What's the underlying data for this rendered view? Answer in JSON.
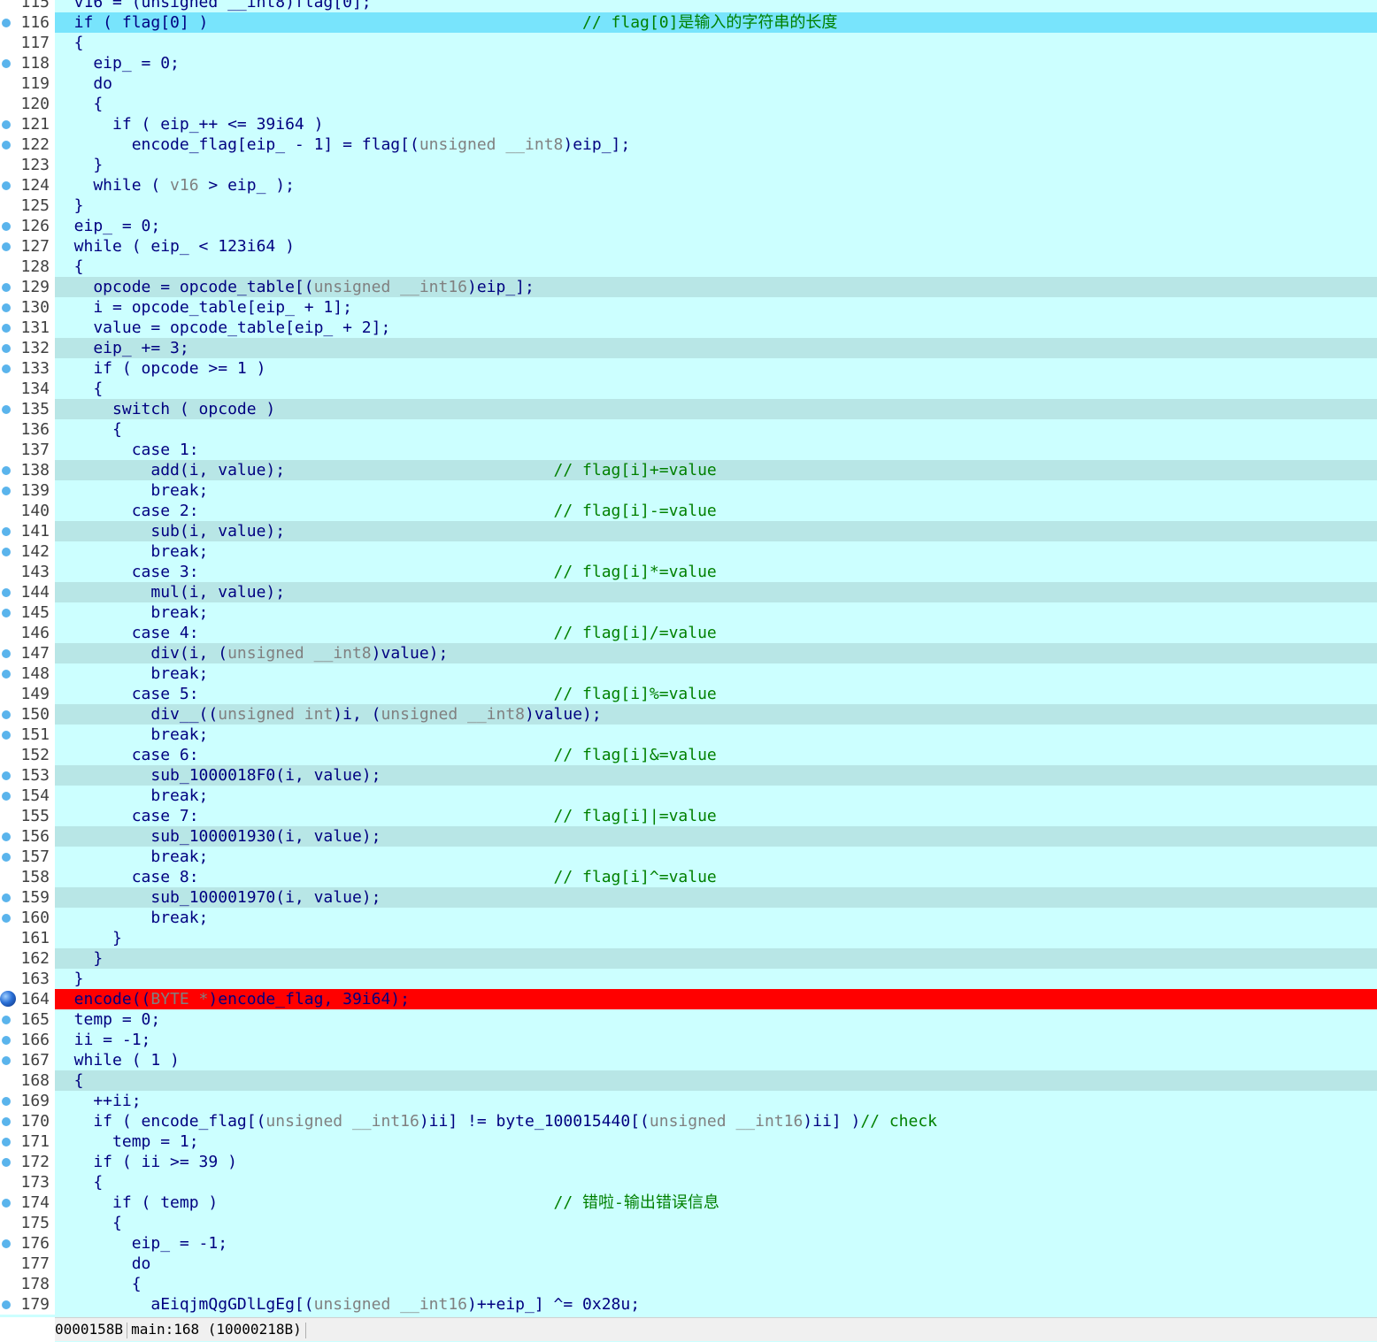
{
  "editor": {
    "lines": [
      {
        "n": "115",
        "seg": [
          [
            "  v16 = (unsigned __int8)flag[0];",
            "nm"
          ]
        ],
        "bp": false,
        "hl": ""
      },
      {
        "n": "116",
        "seg": [
          [
            "  if ( flag[0] )                                       ",
            "nm"
          ],
          [
            "// flag[0]是输入的字符串的长度",
            "cm"
          ]
        ],
        "bp": true,
        "hl": "cur"
      },
      {
        "n": "117",
        "seg": [
          [
            "  {",
            "nm"
          ]
        ],
        "bp": false,
        "hl": ""
      },
      {
        "n": "118",
        "seg": [
          [
            "    eip_ = 0;",
            "nm"
          ]
        ],
        "bp": true,
        "hl": ""
      },
      {
        "n": "119",
        "seg": [
          [
            "    do",
            "nm"
          ]
        ],
        "bp": false,
        "hl": ""
      },
      {
        "n": "120",
        "seg": [
          [
            "    {",
            "nm"
          ]
        ],
        "bp": false,
        "hl": ""
      },
      {
        "n": "121",
        "seg": [
          [
            "      if ( eip_++ <= 39i64 )",
            "nm"
          ]
        ],
        "bp": true,
        "hl": ""
      },
      {
        "n": "122",
        "seg": [
          [
            "        encode_flag[eip_ - 1] = flag[(",
            "nm"
          ],
          [
            "unsigned __int8",
            "ty"
          ],
          [
            ")eip_];",
            "nm"
          ]
        ],
        "bp": true,
        "hl": ""
      },
      {
        "n": "123",
        "seg": [
          [
            "    }",
            "nm"
          ]
        ],
        "bp": false,
        "hl": ""
      },
      {
        "n": "124",
        "seg": [
          [
            "    while ( ",
            "nm"
          ],
          [
            "v16",
            "ty"
          ],
          [
            " > eip_ );",
            "nm"
          ]
        ],
        "bp": true,
        "hl": ""
      },
      {
        "n": "125",
        "seg": [
          [
            "  }",
            "nm"
          ]
        ],
        "bp": false,
        "hl": ""
      },
      {
        "n": "126",
        "seg": [
          [
            "  eip_ = 0;",
            "nm"
          ]
        ],
        "bp": true,
        "hl": ""
      },
      {
        "n": "127",
        "seg": [
          [
            "  while ( eip_ < 123i64 )",
            "nm"
          ]
        ],
        "bp": true,
        "hl": ""
      },
      {
        "n": "128",
        "seg": [
          [
            "  {",
            "nm"
          ]
        ],
        "bp": false,
        "hl": ""
      },
      {
        "n": "129",
        "seg": [
          [
            "    opcode = opcode_table[(",
            "nm"
          ],
          [
            "unsigned __int16",
            "ty"
          ],
          [
            ")eip_];",
            "nm"
          ]
        ],
        "bp": true,
        "hl": "alt"
      },
      {
        "n": "130",
        "seg": [
          [
            "    i = opcode_table[eip_ + 1];",
            "nm"
          ]
        ],
        "bp": true,
        "hl": ""
      },
      {
        "n": "131",
        "seg": [
          [
            "    value = opcode_table[eip_ + 2];",
            "nm"
          ]
        ],
        "bp": true,
        "hl": ""
      },
      {
        "n": "132",
        "seg": [
          [
            "    eip_ += 3;",
            "nm"
          ]
        ],
        "bp": true,
        "hl": "alt"
      },
      {
        "n": "133",
        "seg": [
          [
            "    if ( opcode >= 1 )",
            "nm"
          ]
        ],
        "bp": true,
        "hl": ""
      },
      {
        "n": "134",
        "seg": [
          [
            "    {",
            "nm"
          ]
        ],
        "bp": false,
        "hl": ""
      },
      {
        "n": "135",
        "seg": [
          [
            "      switch ( opcode )",
            "nm"
          ]
        ],
        "bp": true,
        "hl": "alt"
      },
      {
        "n": "136",
        "seg": [
          [
            "      {",
            "nm"
          ]
        ],
        "bp": false,
        "hl": ""
      },
      {
        "n": "137",
        "seg": [
          [
            "        case 1:",
            "nm"
          ]
        ],
        "bp": false,
        "hl": ""
      },
      {
        "n": "138",
        "seg": [
          [
            "          add(i, value);                            ",
            "nm"
          ],
          [
            "// flag[i]+=value",
            "cm"
          ]
        ],
        "bp": true,
        "hl": "alt"
      },
      {
        "n": "139",
        "seg": [
          [
            "          break;",
            "nm"
          ]
        ],
        "bp": true,
        "hl": ""
      },
      {
        "n": "140",
        "seg": [
          [
            "        case 2:                                     ",
            "nm"
          ],
          [
            "// flag[i]-=value",
            "cm"
          ]
        ],
        "bp": false,
        "hl": ""
      },
      {
        "n": "141",
        "seg": [
          [
            "          sub(i, value);",
            "nm"
          ]
        ],
        "bp": true,
        "hl": "alt"
      },
      {
        "n": "142",
        "seg": [
          [
            "          break;",
            "nm"
          ]
        ],
        "bp": true,
        "hl": ""
      },
      {
        "n": "143",
        "seg": [
          [
            "        case 3:                                     ",
            "nm"
          ],
          [
            "// flag[i]*=value",
            "cm"
          ]
        ],
        "bp": false,
        "hl": ""
      },
      {
        "n": "144",
        "seg": [
          [
            "          mul(i, value);",
            "nm"
          ]
        ],
        "bp": true,
        "hl": "alt"
      },
      {
        "n": "145",
        "seg": [
          [
            "          break;",
            "nm"
          ]
        ],
        "bp": true,
        "hl": ""
      },
      {
        "n": "146",
        "seg": [
          [
            "        case 4:                                     ",
            "nm"
          ],
          [
            "// flag[i]/=value",
            "cm"
          ]
        ],
        "bp": false,
        "hl": ""
      },
      {
        "n": "147",
        "seg": [
          [
            "          div(i, (",
            "nm"
          ],
          [
            "unsigned __int8",
            "ty"
          ],
          [
            ")value);",
            "nm"
          ]
        ],
        "bp": true,
        "hl": "alt"
      },
      {
        "n": "148",
        "seg": [
          [
            "          break;",
            "nm"
          ]
        ],
        "bp": true,
        "hl": ""
      },
      {
        "n": "149",
        "seg": [
          [
            "        case 5:                                     ",
            "nm"
          ],
          [
            "// flag[i]%=value",
            "cm"
          ]
        ],
        "bp": false,
        "hl": ""
      },
      {
        "n": "150",
        "seg": [
          [
            "          div__((",
            "nm"
          ],
          [
            "unsigned int",
            "ty"
          ],
          [
            ")i, (",
            "nm"
          ],
          [
            "unsigned __int8",
            "ty"
          ],
          [
            ")value);",
            "nm"
          ]
        ],
        "bp": true,
        "hl": "alt"
      },
      {
        "n": "151",
        "seg": [
          [
            "          break;",
            "nm"
          ]
        ],
        "bp": true,
        "hl": ""
      },
      {
        "n": "152",
        "seg": [
          [
            "        case 6:                                     ",
            "nm"
          ],
          [
            "// flag[i]&=value",
            "cm"
          ]
        ],
        "bp": false,
        "hl": ""
      },
      {
        "n": "153",
        "seg": [
          [
            "          sub_1000018F0(i, value);",
            "nm"
          ]
        ],
        "bp": true,
        "hl": "alt"
      },
      {
        "n": "154",
        "seg": [
          [
            "          break;",
            "nm"
          ]
        ],
        "bp": true,
        "hl": ""
      },
      {
        "n": "155",
        "seg": [
          [
            "        case 7:                                     ",
            "nm"
          ],
          [
            "// flag[i]|=value",
            "cm"
          ]
        ],
        "bp": false,
        "hl": ""
      },
      {
        "n": "156",
        "seg": [
          [
            "          sub_100001930(i, value);",
            "nm"
          ]
        ],
        "bp": true,
        "hl": "alt"
      },
      {
        "n": "157",
        "seg": [
          [
            "          break;",
            "nm"
          ]
        ],
        "bp": true,
        "hl": ""
      },
      {
        "n": "158",
        "seg": [
          [
            "        case 8:                                     ",
            "nm"
          ],
          [
            "// flag[i]^=value",
            "cm"
          ]
        ],
        "bp": false,
        "hl": ""
      },
      {
        "n": "159",
        "seg": [
          [
            "          sub_100001970(i, value);",
            "nm"
          ]
        ],
        "bp": true,
        "hl": "alt"
      },
      {
        "n": "160",
        "seg": [
          [
            "          break;",
            "nm"
          ]
        ],
        "bp": true,
        "hl": ""
      },
      {
        "n": "161",
        "seg": [
          [
            "      }",
            "nm"
          ]
        ],
        "bp": false,
        "hl": ""
      },
      {
        "n": "162",
        "seg": [
          [
            "    }",
            "nm"
          ]
        ],
        "bp": false,
        "hl": "alt"
      },
      {
        "n": "163",
        "seg": [
          [
            "  }",
            "nm"
          ]
        ],
        "bp": false,
        "hl": ""
      },
      {
        "n": "164",
        "seg": [
          [
            "  encode((",
            "nm"
          ],
          [
            "BYTE *",
            "ty"
          ],
          [
            ")encode_flag, 39i64);",
            "nm"
          ]
        ],
        "bp": true,
        "hl": "bpl",
        "big": true
      },
      {
        "n": "165",
        "seg": [
          [
            "  temp = 0;",
            "nm"
          ]
        ],
        "bp": true,
        "hl": ""
      },
      {
        "n": "166",
        "seg": [
          [
            "  ii = -1;",
            "nm"
          ]
        ],
        "bp": true,
        "hl": ""
      },
      {
        "n": "167",
        "seg": [
          [
            "  while ( 1 )",
            "nm"
          ]
        ],
        "bp": true,
        "hl": ""
      },
      {
        "n": "168",
        "seg": [
          [
            "  {",
            "nm"
          ]
        ],
        "bp": false,
        "hl": "alt"
      },
      {
        "n": "169",
        "seg": [
          [
            "    ++ii;",
            "nm"
          ]
        ],
        "bp": true,
        "hl": ""
      },
      {
        "n": "170",
        "seg": [
          [
            "    if ( encode_flag[(",
            "nm"
          ],
          [
            "unsigned __int16",
            "ty"
          ],
          [
            ")ii] != byte_100015440[(",
            "nm"
          ],
          [
            "unsigned __int16",
            "ty"
          ],
          [
            ")ii] )",
            "nm"
          ],
          [
            "// check",
            "cm"
          ]
        ],
        "bp": true,
        "hl": ""
      },
      {
        "n": "171",
        "seg": [
          [
            "      temp = 1;",
            "nm"
          ]
        ],
        "bp": true,
        "hl": ""
      },
      {
        "n": "172",
        "seg": [
          [
            "    if ( ii >= 39 )",
            "nm"
          ]
        ],
        "bp": true,
        "hl": ""
      },
      {
        "n": "173",
        "seg": [
          [
            "    {",
            "nm"
          ]
        ],
        "bp": false,
        "hl": ""
      },
      {
        "n": "174",
        "seg": [
          [
            "      if ( temp )                                   ",
            "nm"
          ],
          [
            "// 错啦-输出错误信息",
            "cm"
          ]
        ],
        "bp": true,
        "hl": ""
      },
      {
        "n": "175",
        "seg": [
          [
            "      {",
            "nm"
          ]
        ],
        "bp": false,
        "hl": ""
      },
      {
        "n": "176",
        "seg": [
          [
            "        eip_ = -1;",
            "nm"
          ]
        ],
        "bp": true,
        "hl": ""
      },
      {
        "n": "177",
        "seg": [
          [
            "        do",
            "nm"
          ]
        ],
        "bp": false,
        "hl": ""
      },
      {
        "n": "178",
        "seg": [
          [
            "        {",
            "nm"
          ]
        ],
        "bp": false,
        "hl": ""
      },
      {
        "n": "179",
        "seg": [
          [
            "          aEiqjmQgGDlLgEg[(",
            "nm"
          ],
          [
            "unsigned __int16",
            "ty"
          ],
          [
            ")++eip_] ^= 0x28u;",
            "nm"
          ]
        ],
        "bp": true,
        "hl": ""
      }
    ]
  },
  "status": {
    "offset": "0000158B",
    "location": "main:168",
    "address": "(10000218B)"
  },
  "colors": {
    "background": "#ccffff",
    "current_line": "#78e4fc",
    "breakpoint_line": "#ff0000",
    "comment": "#008000",
    "identifier": "#000080",
    "type": "#808080"
  }
}
